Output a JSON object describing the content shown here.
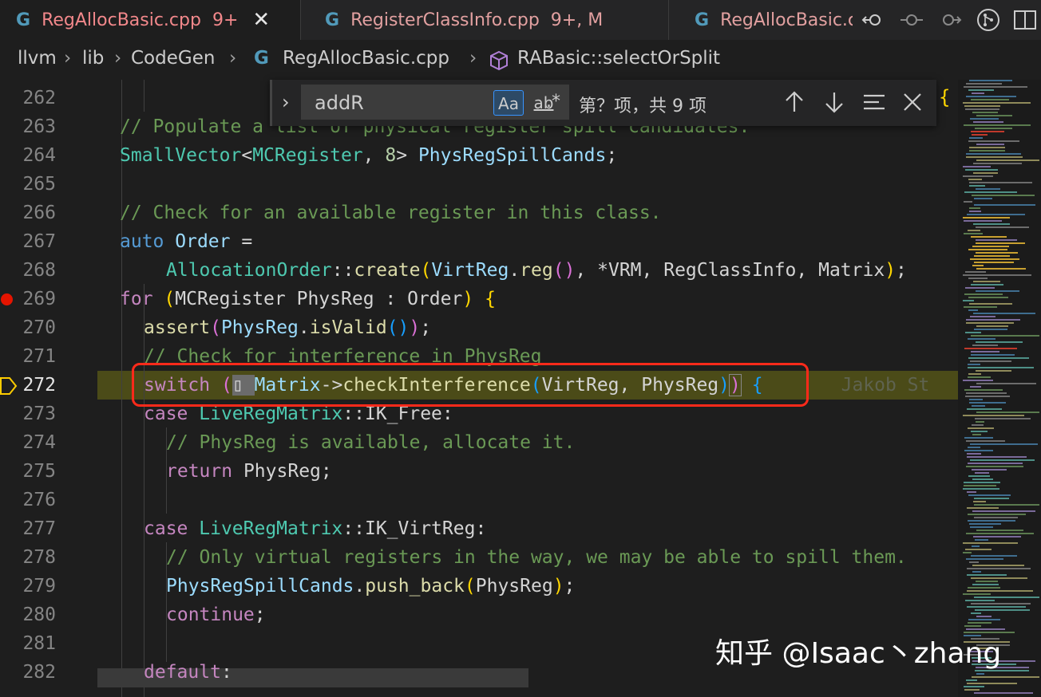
{
  "tabs": [
    {
      "name": "RegAllocBasic.cpp",
      "badge": "9+",
      "active": true
    },
    {
      "name": "RegisterClassInfo.cpp",
      "badge": "9+, M",
      "active": false
    },
    {
      "name": "RegAllocBasic.cpp",
      "badge": "",
      "active": false
    }
  ],
  "breadcrumb": [
    "llvm",
    "lib",
    "CodeGen",
    "RegAllocBasic.cpp",
    "RABasic::selectOrSplit"
  ],
  "find": {
    "value": "addR",
    "match_case": "Aa",
    "whole_word": "ab",
    "regex": ".*",
    "result": "第？项，共 9 项"
  },
  "line_numbers": [
    "262",
    "263",
    "264",
    "265",
    "266",
    "267",
    "268",
    "269",
    "270",
    "271",
    "272",
    "273",
    "274",
    "275",
    "276",
    "277",
    "278",
    "279",
    "280",
    "281",
    "282"
  ],
  "current_line": "272",
  "breakpoint_line": "269",
  "code": {
    "l263_comment": "// Populate a list of physical register spill candidates.",
    "l264_type": "SmallVector",
    "l264_arg": "MCRegister",
    "l264_num": "8",
    "l264_var": "PhysRegSpillCands",
    "l266_comment": "// Check for an available register in this class.",
    "l267_kw": "auto",
    "l267_var": "Order",
    "l268_type": "AllocationOrder",
    "l268_fn": "create",
    "l268_a1": "VirtReg",
    "l268_a1fn": "reg",
    "l268_a2": "VRM",
    "l268_a3": "RegClassInfo",
    "l268_a4": "Matrix",
    "l269_kw": "for",
    "l269_type": "MCRegister",
    "l269_var": "PhysReg",
    "l269_range": "Order",
    "l270_fn": "assert",
    "l270_var": "PhysReg",
    "l270_m": "isValid",
    "l271_comment": "// Check for interference in PhysReg",
    "l272_kw": "switch",
    "l272_obj": "Matrix",
    "l272_fn": "checkInterference",
    "l272_a1": "VirtReg",
    "l272_a2": "PhysReg",
    "l272_blame": "Jakob St",
    "l273_kw": "case",
    "l273_type": "LiveRegMatrix",
    "l273_val": "IK_Free",
    "l274_comment": "// PhysReg is available, allocate it.",
    "l275_kw": "return",
    "l275_var": "PhysReg",
    "l277_kw": "case",
    "l277_type": "LiveRegMatrix",
    "l277_val": "IK_VirtReg",
    "l278_comment": "// Only virtual registers in the way, we may be able to spill them.",
    "l279_var": "PhysRegSpillCands",
    "l279_fn": "push_back",
    "l279_arg": "PhysReg",
    "l280_kw": "continue",
    "l282_kw": "default"
  },
  "watermark": "知乎 @Isaac丶zhang",
  "colors": {
    "accent": "#3794ff",
    "highlight_box": "#ff2a1a",
    "breakpoint": "#e51400"
  }
}
